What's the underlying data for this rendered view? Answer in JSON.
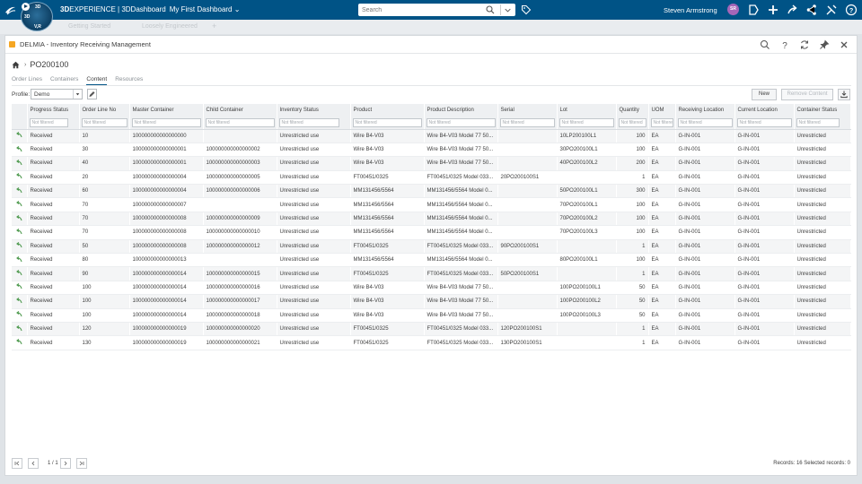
{
  "topbar": {
    "compass_top": "3D",
    "compass_left": "3D",
    "compass_bottom": "V,R",
    "brand_prefix": "3D",
    "brand_experience": "EXPERIENCE | 3DDashboard",
    "dashboard": "My First Dashboard",
    "search_placeholder": "Search",
    "user": "Steven Armstrong",
    "avatar": "SR"
  },
  "tabstrip": {
    "tab1": "Getting Started",
    "tab2": "Loosely Engineered"
  },
  "widget": {
    "title": "DELMIA - Inventory Receiving Management",
    "breadcrumb": "PO200100",
    "tabs": [
      "Order Lines",
      "Containers",
      "Content",
      "Resources"
    ],
    "active_tab": "Content",
    "profile_label": "Profile:",
    "profile_value": "Demo",
    "new_label": "New",
    "remove_label": "Remove Content"
  },
  "grid": {
    "columns": [
      "Progress Status",
      "Order Line No",
      "Master Container",
      "Child Container",
      "Inventory Status",
      "Product",
      "Product Description",
      "Serial",
      "Lot",
      "Quantity",
      "UOM",
      "Receiving Location",
      "Current Location",
      "Container Status"
    ],
    "filter_placeholder": "Not filtered",
    "rows": [
      [
        "Received",
        "10",
        "100000000000000000",
        "",
        "Unrestricted use",
        "Wire B4-V03",
        "Wire B4-V03 Model 77 50...",
        "",
        "10LP200100L1",
        "100",
        "EA",
        "G-IN-001",
        "G-IN-001",
        "Unrestricted"
      ],
      [
        "Received",
        "30",
        "100000000000000001",
        "100000000000000002",
        "Unrestricted use",
        "Wire B4-V03",
        "Wire B4-V03 Model 77 50...",
        "",
        "30PO200100L1",
        "100",
        "EA",
        "G-IN-001",
        "G-IN-001",
        "Unrestricted"
      ],
      [
        "Received",
        "40",
        "100000000000000001",
        "100000000000000003",
        "Unrestricted use",
        "Wire B4-V03",
        "Wire B4-V03 Model 77 50...",
        "",
        "40PO200100L2",
        "200",
        "EA",
        "G-IN-001",
        "G-IN-001",
        "Unrestricted"
      ],
      [
        "Received",
        "20",
        "100000000000000004",
        "100000000000000005",
        "Unrestricted use",
        "FT00451/0325",
        "FT00451/0325 Model 033...",
        "20PO200100S1",
        "",
        "1",
        "EA",
        "G-IN-001",
        "G-IN-001",
        "Unrestricted"
      ],
      [
        "Received",
        "60",
        "100000000000000004",
        "100000000000000006",
        "Unrestricted use",
        "MM131456/5564",
        "MM131456/5564 Model 0...",
        "",
        "50PO200100L1",
        "300",
        "EA",
        "G-IN-001",
        "G-IN-001",
        "Unrestricted"
      ],
      [
        "Received",
        "70",
        "100000000000000007",
        "",
        "Unrestricted use",
        "MM131456/5564",
        "MM131456/5564 Model 0...",
        "",
        "70PO200100L1",
        "100",
        "EA",
        "G-IN-001",
        "G-IN-001",
        "Unrestricted"
      ],
      [
        "Received",
        "70",
        "100000000000000008",
        "100000000000000009",
        "Unrestricted use",
        "MM131456/5564",
        "MM131456/5564 Model 0...",
        "",
        "70PO200100L2",
        "100",
        "EA",
        "G-IN-001",
        "G-IN-001",
        "Unrestricted"
      ],
      [
        "Received",
        "70",
        "100000000000000008",
        "100000000000000010",
        "Unrestricted use",
        "MM131456/5564",
        "MM131456/5564 Model 0...",
        "",
        "70PO200100L3",
        "100",
        "EA",
        "G-IN-001",
        "G-IN-001",
        "Unrestricted"
      ],
      [
        "Received",
        "50",
        "100000000000000008",
        "100000000000000012",
        "Unrestricted use",
        "FT00451/0325",
        "FT00451/0325 Model 033...",
        "90PO200100S1",
        "",
        "1",
        "EA",
        "G-IN-001",
        "G-IN-001",
        "Unrestricted"
      ],
      [
        "Received",
        "80",
        "100000000000000013",
        "",
        "Unrestricted use",
        "MM131456/5564",
        "MM131456/5564 Model 0...",
        "",
        "80PO200100L1",
        "100",
        "EA",
        "G-IN-001",
        "G-IN-001",
        "Unrestricted"
      ],
      [
        "Received",
        "90",
        "100000000000000014",
        "100000000000000015",
        "Unrestricted use",
        "FT00451/0325",
        "FT00451/0325 Model 033...",
        "50PO200100S1",
        "",
        "1",
        "EA",
        "G-IN-001",
        "G-IN-001",
        "Unrestricted"
      ],
      [
        "Received",
        "100",
        "100000000000000014",
        "100000000000000016",
        "Unrestricted use",
        "Wire B4-V03",
        "Wire B4-V03 Model 77 50...",
        "",
        "100PO200100L1",
        "50",
        "EA",
        "G-IN-001",
        "G-IN-001",
        "Unrestricted"
      ],
      [
        "Received",
        "100",
        "100000000000000014",
        "100000000000000017",
        "Unrestricted use",
        "Wire B4-V03",
        "Wire B4-V03 Model 77 50...",
        "",
        "100PO200100L2",
        "50",
        "EA",
        "G-IN-001",
        "G-IN-001",
        "Unrestricted"
      ],
      [
        "Received",
        "100",
        "100000000000000014",
        "100000000000000018",
        "Unrestricted use",
        "Wire B4-V03",
        "Wire B4-V03 Model 77 50...",
        "",
        "100PO200100L3",
        "50",
        "EA",
        "G-IN-001",
        "G-IN-001",
        "Unrestricted"
      ],
      [
        "Received",
        "120",
        "100000000000000019",
        "100000000000000020",
        "Unrestricted use",
        "FT00451/0325",
        "FT00451/0325 Model 033...",
        "120PO200100S1",
        "",
        "1",
        "EA",
        "G-IN-001",
        "G-IN-001",
        "Unrestricted"
      ],
      [
        "Received",
        "130",
        "100000000000000019",
        "100000000000000021",
        "Unrestricted use",
        "FT00451/0325",
        "FT00451/0325 Model 033...",
        "130PO200100S1",
        "",
        "1",
        "EA",
        "G-IN-001",
        "G-IN-001",
        "Unrestricted"
      ]
    ]
  },
  "footer": {
    "page": "1 / 1",
    "records": "Records: 16  Selected records: 0"
  },
  "colors": {
    "topbar": "#005386",
    "accent_green": "#4f9a4f",
    "avatar": "#a566b8"
  }
}
